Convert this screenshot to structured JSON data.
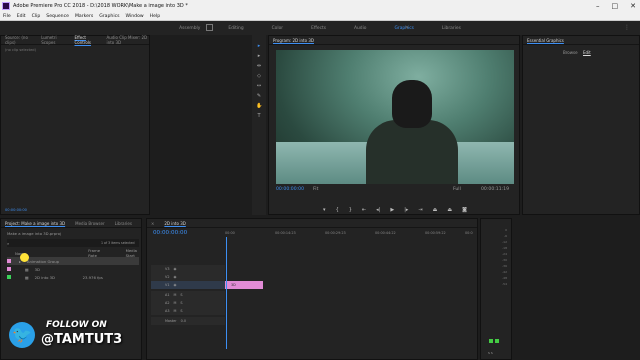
{
  "window": {
    "title": "Adobe Premiere Pro CC 2018 - D:\\2018 WORK\\Make a image into 3D *"
  },
  "menu": [
    "File",
    "Edit",
    "Clip",
    "Sequence",
    "Markers",
    "Graphics",
    "Window",
    "Help"
  ],
  "workspaces": {
    "tabs": [
      "Assembly",
      "Editing",
      "Color",
      "Effects",
      "Audio",
      "Graphics",
      "Libraries"
    ],
    "active": "Graphics"
  },
  "source_panel": {
    "tabs": [
      "Source: (no clips)",
      "Lumetri Scopes",
      "Effect Controls",
      "Audio Clip Mixer: 2D into 3D"
    ],
    "active": "Effect Controls",
    "sub": "(no clip selected)",
    "footer": "00:00:00:00"
  },
  "program": {
    "title": "Program: 2D into 3D",
    "timecode": "00:00:00:00",
    "fit": "Fit",
    "quality": "Full",
    "duration": "00:00:11:19"
  },
  "essential": {
    "title": "Essential Graphics",
    "tabs": [
      "Browse",
      "Edit"
    ]
  },
  "project": {
    "tabs": [
      "Project: Make a image into 3D",
      "Media Browser",
      "Libraries"
    ],
    "file": "Make a image into 3D.prproj",
    "selection": "1 of 3 items selected",
    "columns": [
      "Name",
      "Frame Rate",
      "Media Start"
    ],
    "items": [
      {
        "name": "Animation Group",
        "rate": "",
        "color": "#e28bd6"
      },
      {
        "name": "3D",
        "rate": "",
        "color": "#e28bd6"
      },
      {
        "name": "2D into 3D",
        "rate": "23.976 fps",
        "color": "#3bd25a"
      }
    ]
  },
  "timeline": {
    "tab": "2D into 3D",
    "timecode": "00:00:00:00",
    "ruler": [
      "00:00",
      "00:00:14:23",
      "00:00:29:23",
      "00:00:44:22",
      "00:00:59:22",
      "00:0"
    ],
    "tracks": [
      "V3",
      "V2",
      "V1",
      "A1",
      "A2",
      "A3"
    ],
    "master": {
      "label": "Master",
      "value": "0.0"
    },
    "clip": "3D"
  },
  "meters": {
    "scale": [
      "0",
      "-6",
      "-12",
      "-18",
      "-24",
      "-30",
      "-36",
      "-42",
      "-48",
      "-54"
    ],
    "footer": "S S"
  },
  "watermark": {
    "follow": "FOLLOW ON",
    "handle": "@TAMTUT3"
  },
  "colors": {
    "accent": "#3d8ff3",
    "panel": "#232323",
    "clip_pink": "#e28bd6",
    "meter_green": "#44cc44"
  }
}
